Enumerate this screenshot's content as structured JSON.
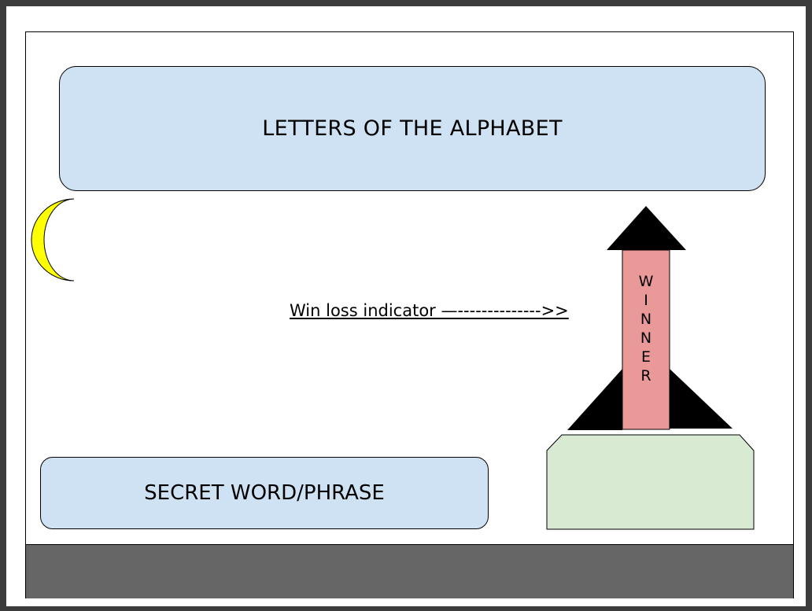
{
  "alphabet_box": {
    "label": "LETTERS OF THE ALPHABET"
  },
  "secret_box": {
    "label": "SECRET WORD/PHRASE"
  },
  "indicator": {
    "text": "Win loss indicator —-------------->>"
  },
  "rocket": {
    "status_letters": [
      "W",
      "I",
      "N",
      "N",
      "E",
      "R"
    ]
  },
  "colors": {
    "box_fill": "#cfe2f3",
    "rocket_body": "#ea9999",
    "launchpad": "#d9ead3",
    "moon": "#ffff00",
    "ground": "#666666"
  },
  "icons": {
    "moon": "crescent-moon-icon",
    "rocket": "rocket-icon"
  }
}
